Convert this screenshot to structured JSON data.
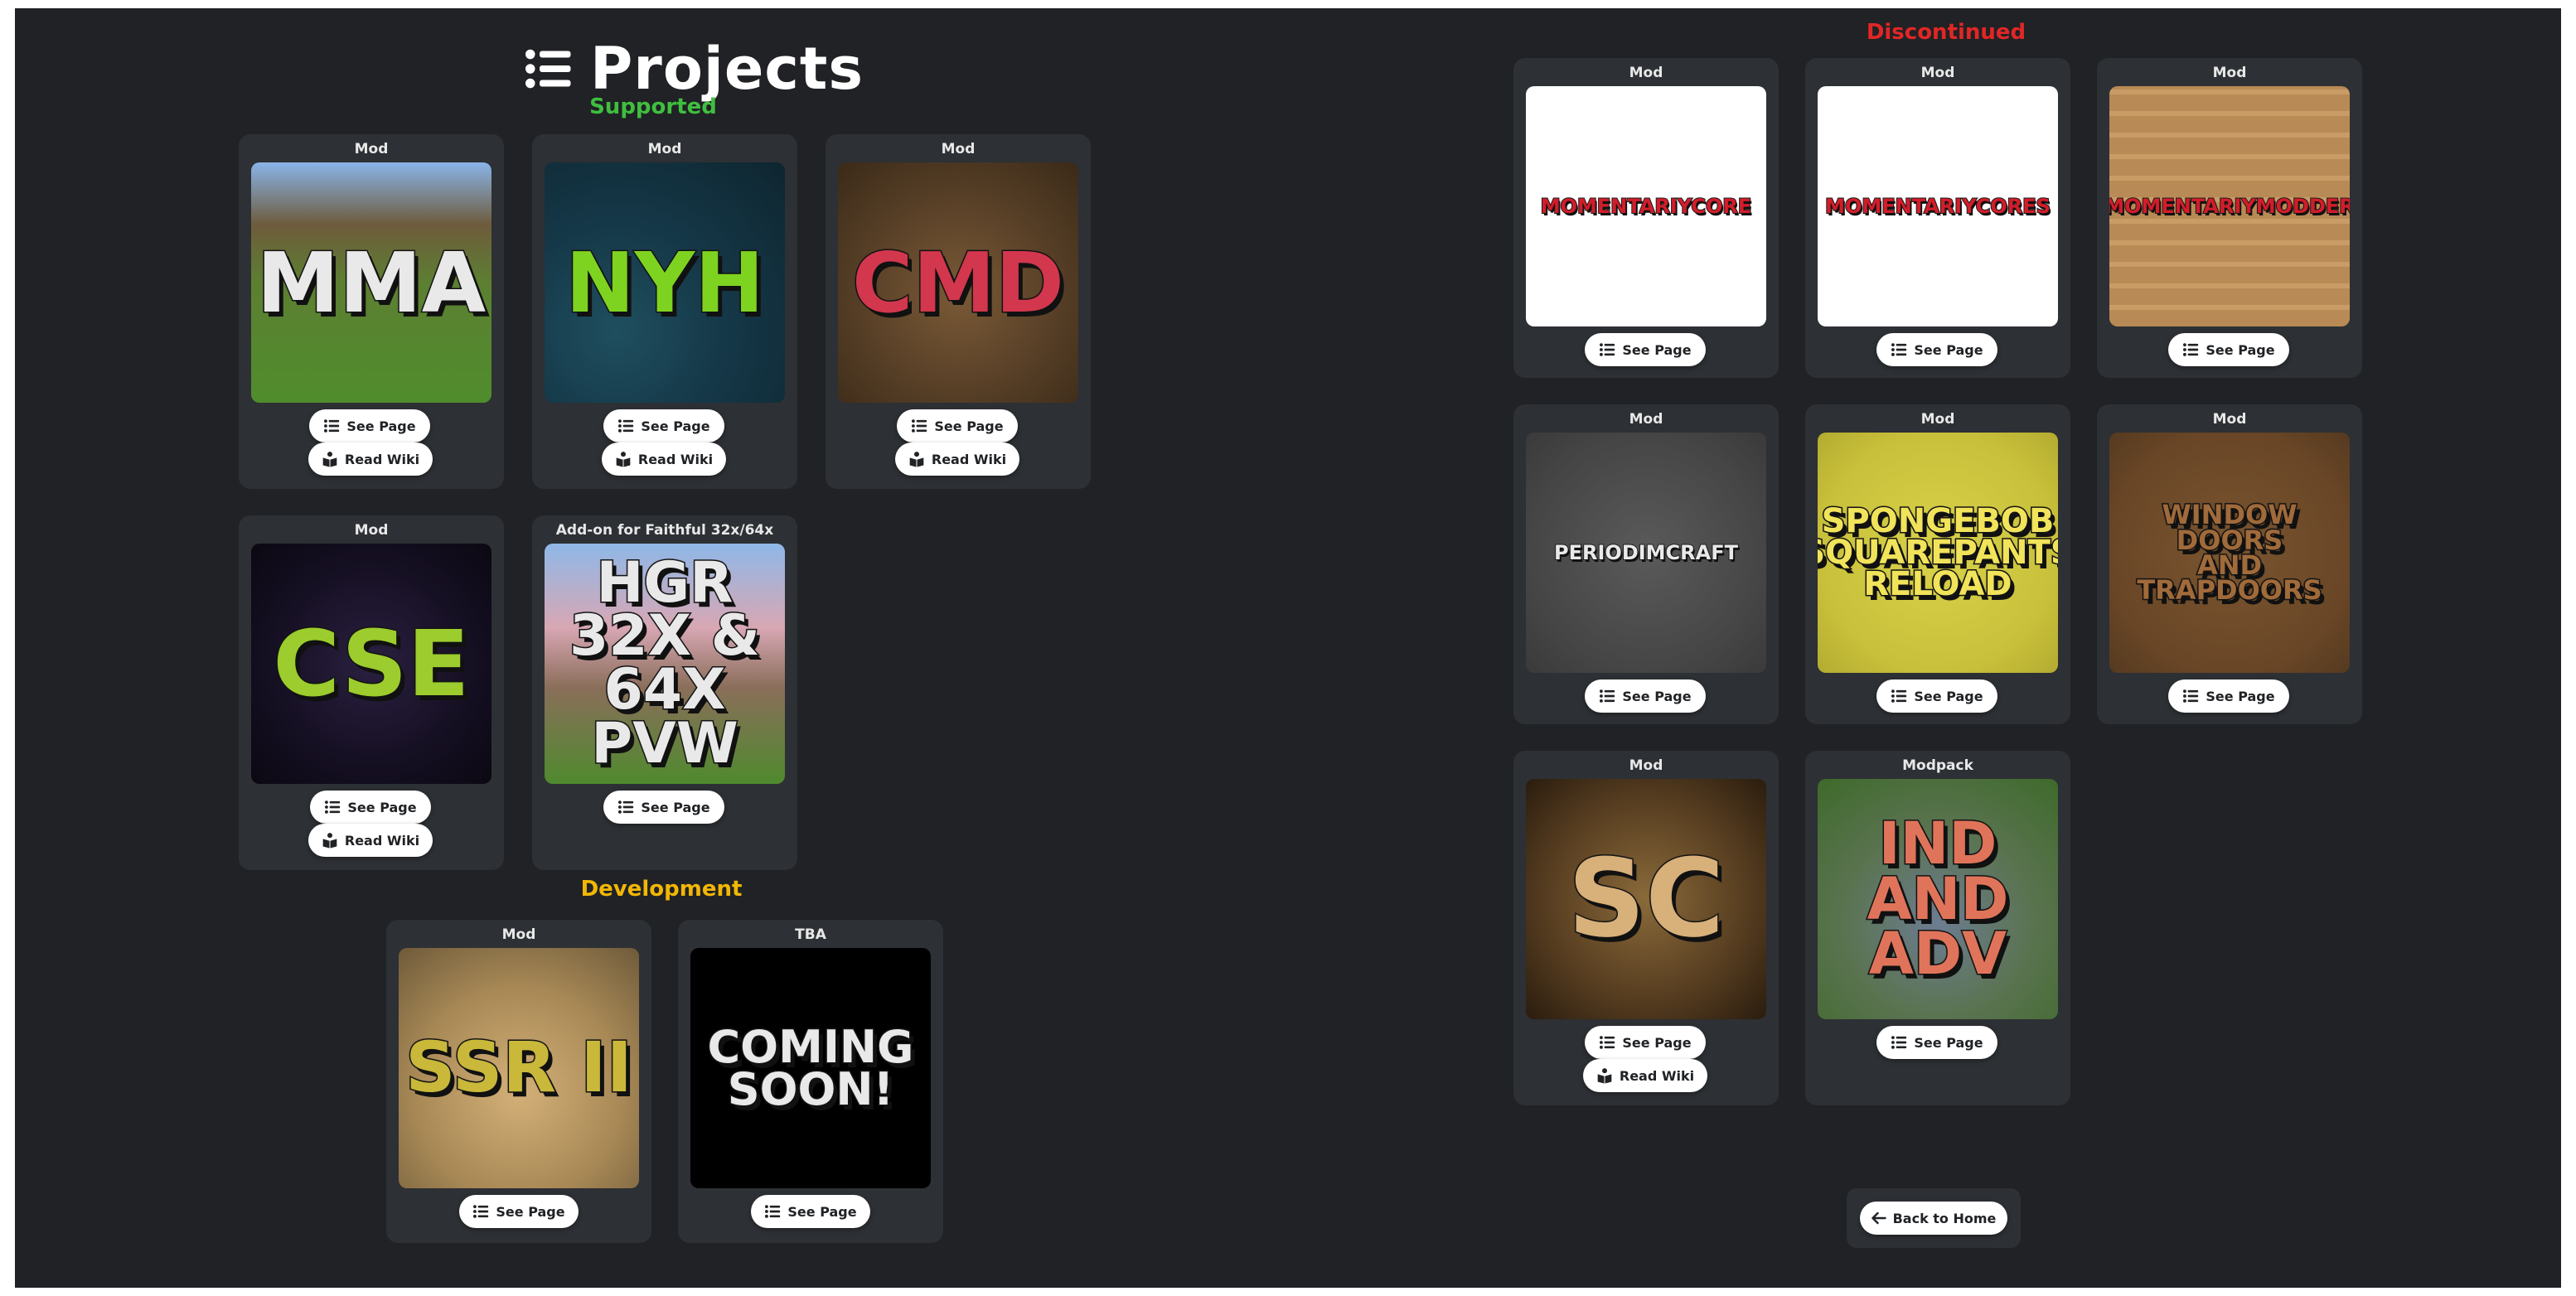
{
  "header": {
    "title": "Projects",
    "icon": "list-icon"
  },
  "sections": {
    "supported": "Supported",
    "development": "Development",
    "discontinued": "Discontinued"
  },
  "colors": {
    "background": "#202225",
    "card": "#2d3034",
    "supported": "#3fbf3f",
    "development": "#f2b705",
    "discontinued": "#e22626",
    "button": "#ffffff"
  },
  "buttons": {
    "see_page": "See Page",
    "read_wiki": "Read Wiki",
    "back_home": "Back to Home"
  },
  "icons": {
    "see_page": "list-icon",
    "read_wiki": "book-reader-icon",
    "back_home": "arrow-left-icon"
  },
  "supported_cards": [
    {
      "type": "Mod",
      "logo": "MMA"
    },
    {
      "type": "Mod",
      "logo": "NYH"
    },
    {
      "type": "Mod",
      "logo": "CMD"
    },
    {
      "type": "Mod",
      "logo": "CSE"
    },
    {
      "type": "Add-on for Faithful 32x/64x",
      "logo": "HGR\n32X & 64X\nPVW"
    }
  ],
  "development_cards": [
    {
      "type": "Mod",
      "logo": "SSR II"
    },
    {
      "type": "TBA",
      "logo": "COMING\nSOON!"
    }
  ],
  "discontinued_cards": [
    {
      "type": "Mod",
      "logo": "MOMENTARIYCORE"
    },
    {
      "type": "Mod",
      "logo": "MOMENTARIYCORES"
    },
    {
      "type": "Mod",
      "logo": "MOMENTARIYMODDER"
    },
    {
      "type": "Mod",
      "logo": "PERIODIMCRAFT"
    },
    {
      "type": "Mod",
      "logo": "SPONGEBOB\nSQUAREPANTS\nRELOAD"
    },
    {
      "type": "Mod",
      "logo": "WINDOW DOORS\nAND TRAPDOORS"
    },
    {
      "type": "Mod",
      "logo": "SC"
    },
    {
      "type": "Modpack",
      "logo": "IND\nAND\nADV"
    }
  ]
}
